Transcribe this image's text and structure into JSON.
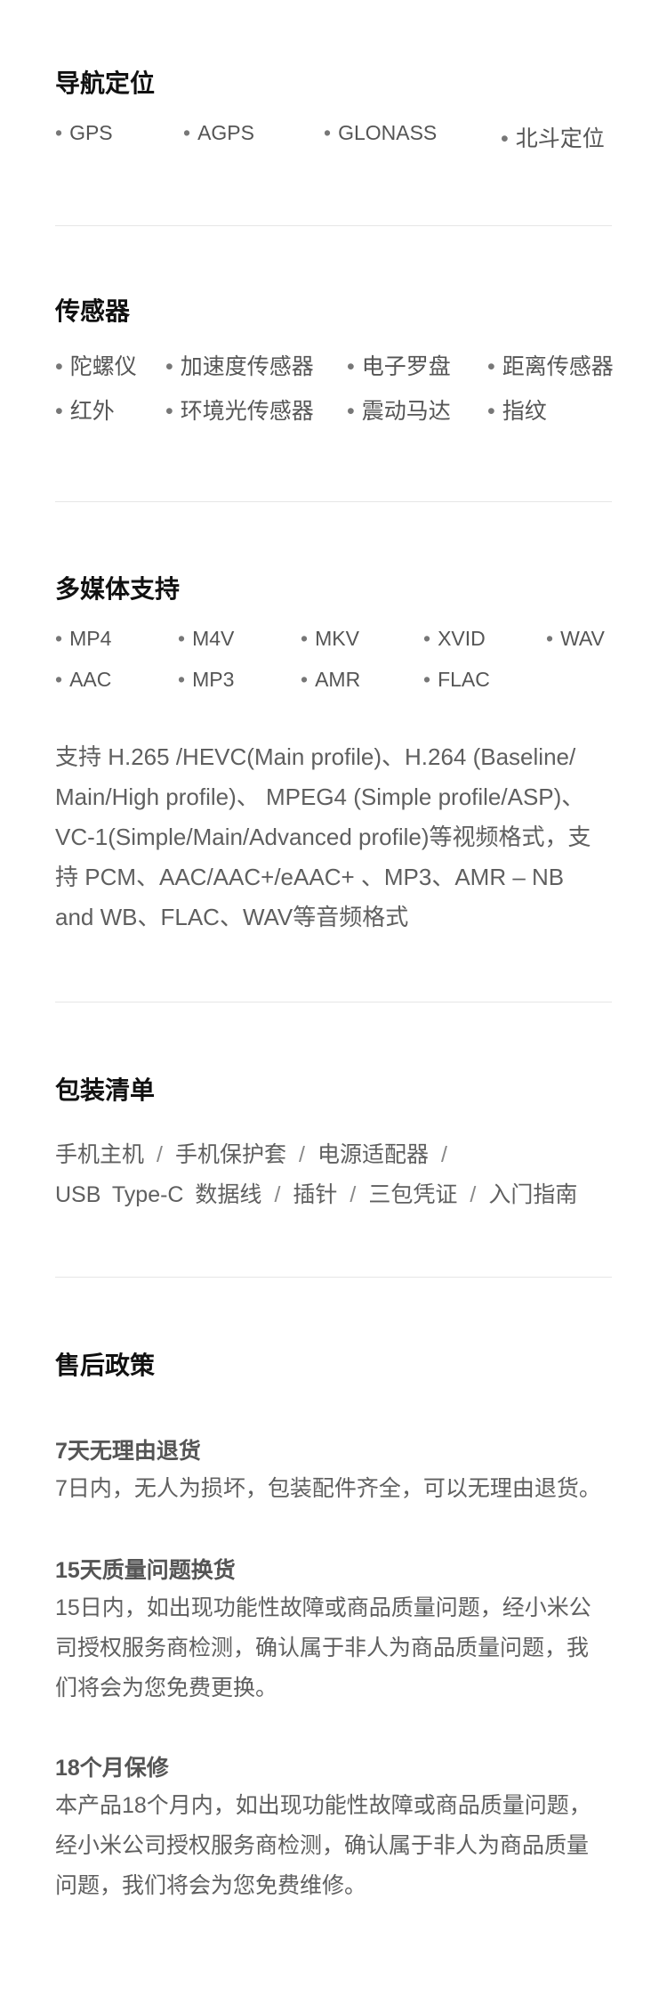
{
  "navigation": {
    "title": "导航定位",
    "items": [
      "GPS",
      "AGPS",
      "GLONASS",
      "北斗定位"
    ]
  },
  "sensors": {
    "title": "传感器",
    "items": [
      "陀螺仪",
      "加速度传感器",
      "电子罗盘",
      "距离传感器",
      "红外",
      "环境光传感器",
      "震动马达",
      "指纹"
    ]
  },
  "multimedia": {
    "title": "多媒体支持",
    "items": [
      "MP4",
      "M4V",
      "MKV",
      "XVID",
      "WAV",
      "AAC",
      "MP3",
      "AMR",
      "FLAC"
    ],
    "description_lines": [
      "支持 H.265 /HEVC(Main profile)、H.264 (Baseline/",
      "Main/High profile)、 MPEG4 (Simple profile/ASP)、",
      "VC-1(Simple/Main/Advanced profile)等视频格式，支",
      "持 PCM、AAC/AAC+/eAAC+ 、MP3、AMR – NB",
      "and WB、FLAC、WAV等音频格式"
    ]
  },
  "package": {
    "title": "包装清单",
    "items": [
      "手机主机",
      "手机保护套",
      "电源适配器",
      "USB Type-C 数据线",
      "插针",
      "三包凭证",
      "入门指南"
    ]
  },
  "after_sales": {
    "title": "售后政策",
    "policies": [
      {
        "heading": "7天无理由退货",
        "lines": [
          "7日内，无人为损坏，包装配件齐全，可以无理由退货。"
        ]
      },
      {
        "heading": "15天质量问题换货",
        "lines": [
          "15日内，如出现功能性故障或商品质量问题，经小米公",
          "司授权服务商检测，确认属于非人为商品质量问题，我",
          "们将会为您免费更换。"
        ]
      },
      {
        "heading": "18个月保修",
        "lines": [
          "本产品18个月内，如出现功能性故障或商品质量问题，",
          "经小米公司授权服务商检测，确认属于非人为商品质量",
          "问题，我们将会为您免费维修。"
        ]
      }
    ]
  }
}
